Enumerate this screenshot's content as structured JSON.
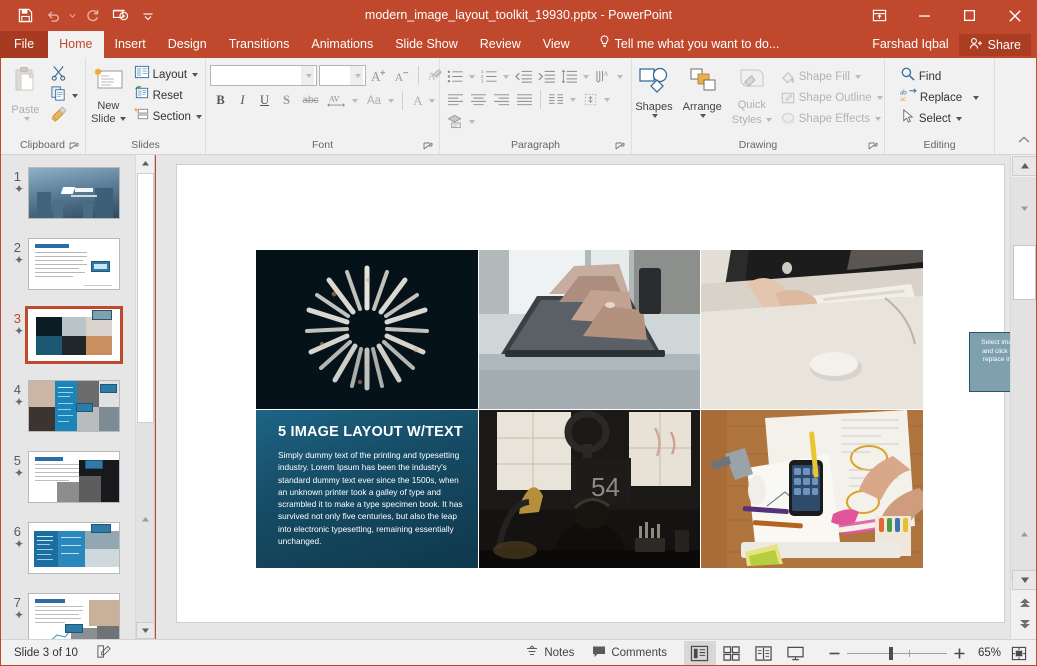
{
  "app": {
    "title": "modern_image_layout_toolkit_19930.pptx - PowerPoint",
    "accent_color": "#c0482c",
    "file_tab_color": "#a83a21"
  },
  "quick_access": [
    {
      "name": "save",
      "icon": "save-icon",
      "label": "Save"
    },
    {
      "name": "undo",
      "icon": "undo-icon",
      "label": "Undo"
    },
    {
      "name": "redo",
      "icon": "redo-icon",
      "label": "Redo"
    },
    {
      "name": "start-from-beginning",
      "icon": "slideshow-icon",
      "label": "Start From Beginning"
    },
    {
      "name": "customize-qat",
      "icon": "chevron-down-icon",
      "label": "Customize Quick Access Toolbar"
    }
  ],
  "window_controls": [
    {
      "name": "ribbon-display-options",
      "label": "Ribbon Display Options"
    },
    {
      "name": "minimize",
      "label": "Minimize"
    },
    {
      "name": "maximize",
      "label": "Restore Down"
    },
    {
      "name": "close",
      "label": "Close"
    }
  ],
  "tabs": [
    {
      "label": "File",
      "active": false,
      "is_file": true
    },
    {
      "label": "Home",
      "active": true,
      "is_file": false
    },
    {
      "label": "Insert",
      "active": false,
      "is_file": false
    },
    {
      "label": "Design",
      "active": false,
      "is_file": false
    },
    {
      "label": "Transitions",
      "active": false,
      "is_file": false
    },
    {
      "label": "Animations",
      "active": false,
      "is_file": false
    },
    {
      "label": "Slide Show",
      "active": false,
      "is_file": false
    },
    {
      "label": "Review",
      "active": false,
      "is_file": false
    },
    {
      "label": "View",
      "active": false,
      "is_file": false
    }
  ],
  "tell_me": {
    "label": "Tell me what you want to do..."
  },
  "account": {
    "user_name": "Farshad Iqbal",
    "share_label": "Share"
  },
  "ribbon": {
    "groups": [
      {
        "name": "clipboard",
        "label": "Clipboard",
        "paste_label": "Paste",
        "cut_label": "Cut",
        "copy_label": "Copy",
        "format_painter_label": "Format Painter",
        "has_launcher": true
      },
      {
        "name": "slides",
        "label": "Slides",
        "new_slide_label": "New\nSlide",
        "new_slide_line1": "New",
        "new_slide_line2": "Slide",
        "layout_label": "Layout",
        "reset_label": "Reset",
        "section_label": "Section",
        "has_launcher": false
      },
      {
        "name": "font",
        "label": "Font",
        "font_name_value": "",
        "font_name_placeholder": "",
        "font_size_value": "",
        "font_size_placeholder": "",
        "increase_font_label": "Increase Font Size",
        "decrease_font_label": "Decrease Font Size",
        "clear_formatting_label": "Clear All Formatting",
        "bold_label": "B",
        "italic_label": "I",
        "underline_label": "U",
        "shadow_label": "S",
        "strikethrough_label": "abc",
        "character_spacing_label": "AV",
        "change_case_label": "Aa",
        "font_color_label": "A",
        "has_launcher": true
      },
      {
        "name": "paragraph",
        "label": "Paragraph",
        "bullets_label": "Bullets",
        "numbering_label": "Numbering",
        "decrease_indent_label": "Decrease List Level",
        "increase_indent_label": "Increase List Level",
        "line_spacing_label": "Line Spacing",
        "text_direction_label": "Text Direction",
        "align_text_label": "Align Text",
        "convert_smartart_label": "Convert to SmartArt",
        "align_left_label": "Align Left",
        "align_center_label": "Center",
        "align_right_label": "Align Right",
        "justify_label": "Justify",
        "columns_label": "Columns",
        "has_launcher": true
      },
      {
        "name": "drawing",
        "label": "Drawing",
        "shapes_label": "Shapes",
        "arrange_label": "Arrange",
        "quick_styles_line1": "Quick",
        "quick_styles_line2": "Styles",
        "shape_fill_label": "Shape Fill",
        "shape_outline_label": "Shape Outline",
        "shape_effects_label": "Shape Effects",
        "has_launcher": true
      },
      {
        "name": "editing",
        "label": "Editing",
        "find_label": "Find",
        "replace_label": "Replace",
        "select_label": "Select",
        "has_launcher": false
      }
    ],
    "collapse_label": "Collapse the Ribbon"
  },
  "thumbnails": {
    "scroll_up_label": "Scroll Up",
    "scroll_down_label": "Scroll Down",
    "slides": [
      {
        "number": "1",
        "has_animation": true,
        "selected": false,
        "kind": "title-city"
      },
      {
        "number": "2",
        "has_animation": true,
        "selected": false,
        "kind": "text-right-image"
      },
      {
        "number": "3",
        "has_animation": true,
        "selected": true,
        "kind": "five-image-layout"
      },
      {
        "number": "4",
        "has_animation": true,
        "selected": false,
        "kind": "image-collage-blue"
      },
      {
        "number": "5",
        "has_animation": true,
        "selected": false,
        "kind": "text-left-photos"
      },
      {
        "number": "6",
        "has_animation": true,
        "selected": false,
        "kind": "blue-panel-photo"
      },
      {
        "number": "7",
        "has_animation": true,
        "selected": false,
        "kind": "text-chart-photos"
      }
    ]
  },
  "slide": {
    "callout": {
      "text": "Select image. Press 'DELETE' and click on the image icon to replace image with your own.",
      "fill": "#7fa0ae",
      "border": "#2b5566"
    },
    "text_block": {
      "title": "5 IMAGE LAYOUT W/TEXT",
      "body": "Simply dummy text of the printing and typesetting industry. Lorem Ipsum has been the industry's standard dummy text ever since the 1500s, when an unknown printer took a galley of type and scrambled it to make a type specimen book. It has survived not only five centuries, but also the leap into electronic typesetting, remaining essentially unchanged.",
      "panel_color": "#1d5872"
    },
    "cells": [
      {
        "name": "image-fireworks",
        "caption": "fireworks on dark background"
      },
      {
        "name": "image-laptop-typing",
        "caption": "hands typing on laptop"
      },
      {
        "name": "image-imac-keyboard",
        "caption": "hands on desktop keyboard"
      },
      {
        "name": "text-panel",
        "caption": "5 image layout with text"
      },
      {
        "name": "image-person-desk",
        "caption": "person at desk with headphones"
      },
      {
        "name": "image-desk-sketching",
        "caption": "hands sketching with phone on desk"
      }
    ]
  },
  "scrollbars": {
    "vertical_up_label": "Line Up",
    "vertical_down_label": "Line Down",
    "previous_slide_label": "Previous Slide",
    "next_slide_label": "Next Slide"
  },
  "status_bar": {
    "slide_indicator": "Slide 3 of 10",
    "accessibility_label": "Accessibility Checker",
    "notes_label": "Notes",
    "comments_label": "Comments",
    "views": [
      {
        "name": "normal-view",
        "label": "Normal",
        "active": true
      },
      {
        "name": "slide-sorter-view",
        "label": "Slide Sorter",
        "active": false
      },
      {
        "name": "reading-view",
        "label": "Reading View",
        "active": false
      },
      {
        "name": "slide-show-view",
        "label": "Slide Show",
        "active": false
      }
    ],
    "zoom_out_label": "Zoom Out",
    "zoom_in_label": "Zoom In",
    "zoom_level": "65%",
    "fit_to_window_label": "Fit slide to current window"
  }
}
